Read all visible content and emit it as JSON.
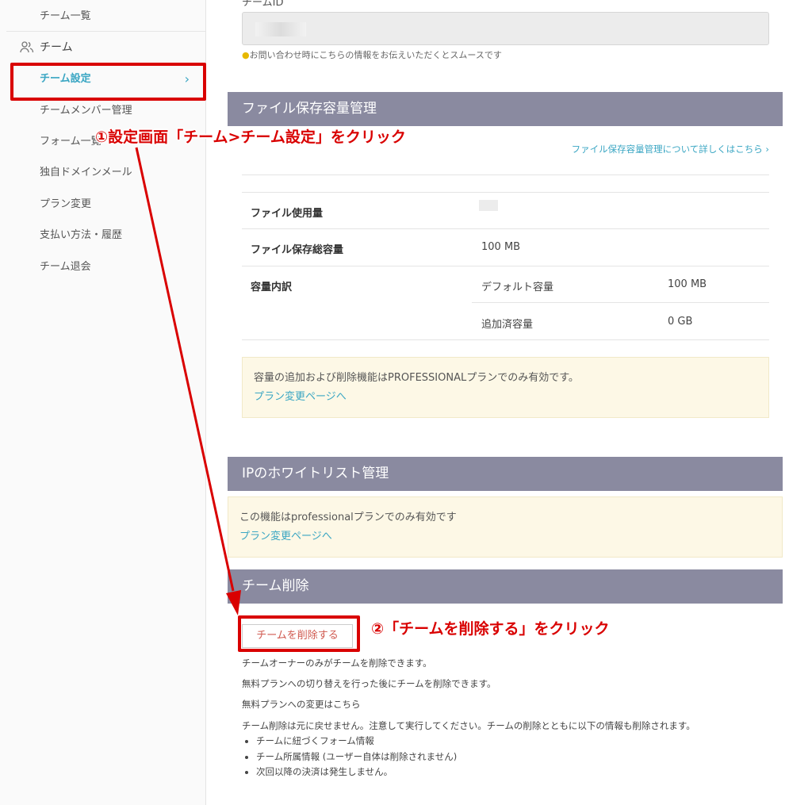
{
  "sidebar": {
    "team_list": "チーム一覧",
    "group_label": "チーム",
    "items": [
      {
        "label": "チーム設定"
      },
      {
        "label": "チームメンバー管理"
      },
      {
        "label": "フォーム一覧"
      },
      {
        "label": "独自ドメインメール"
      },
      {
        "label": "プラン変更"
      },
      {
        "label": "支払い方法・履歴"
      },
      {
        "label": "チーム退会"
      }
    ],
    "active_chevron": "›"
  },
  "team_id": {
    "label": "チームID",
    "hint": "お問い合わせ時にこちらの情報をお伝えいただくとスムースです"
  },
  "storage": {
    "title": "ファイル保存容量管理",
    "details_link": "ファイル保存容量管理について詳しくはこちら",
    "rows": {
      "usage_label": "ファイル使用量",
      "total_label": "ファイル保存総容量",
      "total_value": "100 MB",
      "breakdown_label": "容量内訳",
      "default_label": "デフォルト容量",
      "default_value": "100 MB",
      "added_label": "追加済容量",
      "added_value": "0 GB"
    },
    "notice_text": "容量の追加および削除機能はPROFESSIONALプランでのみ有効です。",
    "notice_link": "プラン変更ページへ"
  },
  "ip_whitelist": {
    "title": "IPのホワイトリスト管理",
    "notice_text": "この機能はprofessionalプランでのみ有効です",
    "notice_link": "プラン変更ページへ"
  },
  "team_delete": {
    "title": "チーム削除",
    "button": "チームを削除する",
    "note1": "チームオーナーのみがチームを削除できます。",
    "note2": "無料プランへの切り替えを行った後にチームを削除できます。",
    "free_plan_link": "無料プランへの変更はこちら",
    "warning": "チーム削除は元に戻せません。注意して実行してください。チームの削除とともに以下の情報も削除されます。",
    "bullets": [
      "チームに紐づくフォーム情報",
      "チーム所属情報 (ユーザー自体は削除されません)",
      "次回以降の決済は発生しません。"
    ]
  },
  "annotations": {
    "step1": "①設定画面「チーム>チーム設定」をクリック",
    "step2": "②「チームを削除する」をクリック",
    "color": "#d90000"
  }
}
